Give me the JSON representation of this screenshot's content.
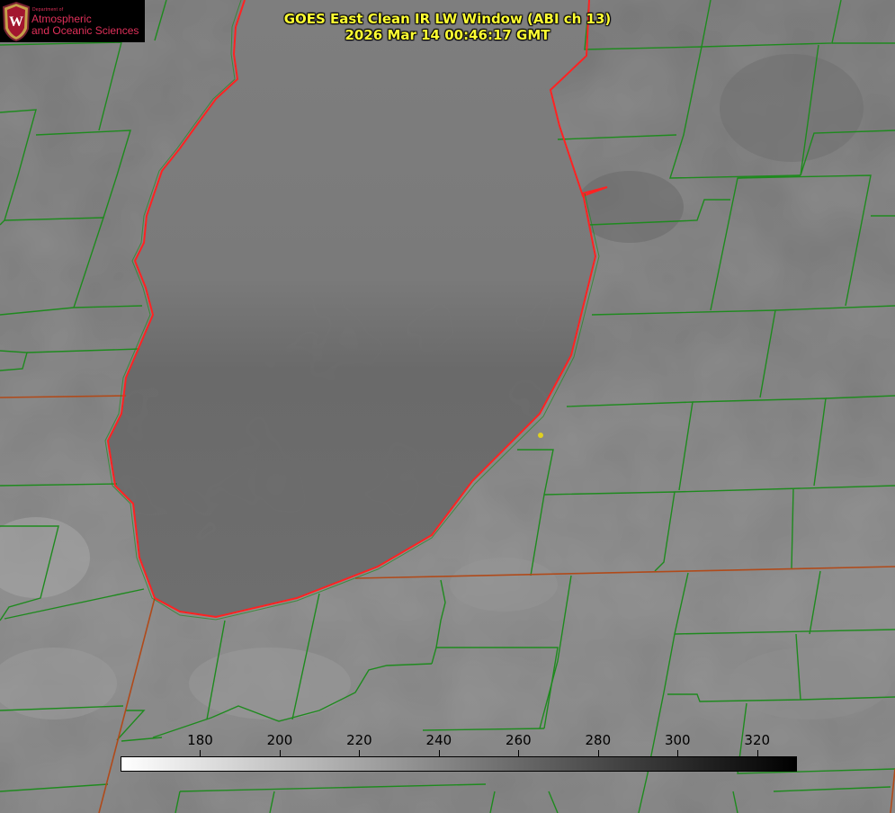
{
  "header": {
    "title_line1": "GOES East Clean IR LW Window (ABI ch 13)",
    "title_line2": "2026 Mar 14 00:46:17 GMT"
  },
  "logo": {
    "dept_text": "Department of",
    "line1": "Atmospheric",
    "line2": "and Oceanic Sciences",
    "seal_icon": "wisconsin-crest-icon"
  },
  "colorbar": {
    "min": 160,
    "max": 330,
    "ticks": [
      "180",
      "200",
      "220",
      "240",
      "260",
      "280",
      "300",
      "320"
    ],
    "gradient_start": "#ffffff",
    "gradient_end": "#000000",
    "units_hint": "K"
  },
  "colors": {
    "county_lines": "#1e8a1e",
    "state_lines": "#b04a1a",
    "lake_shore": "#ff2222",
    "title": "#ffff33",
    "marker": "#e0d020",
    "logo_text": "#e0305a"
  },
  "map": {
    "feature": "Lake Michigan",
    "marker": "location-dot"
  }
}
